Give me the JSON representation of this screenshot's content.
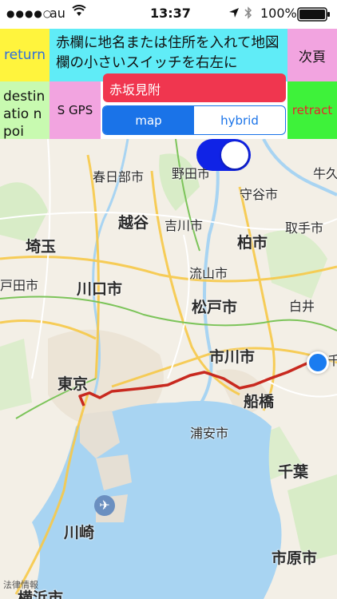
{
  "status": {
    "carrier": "au",
    "time": "13:37",
    "battery": "100%",
    "icons": [
      "signal-dots-icon",
      "wifi-icon",
      "location-arrow-icon",
      "bluetooth-icon",
      "battery-icon"
    ]
  },
  "controls": {
    "return_label": "return",
    "instruction": "赤欄に地名または住所を入れて地図欄の小さいスイッチを右左に",
    "next_label": "次頁",
    "destination_label": "destinatio n poi",
    "gps_label": "S GPS",
    "place_value": "赤坂見附",
    "map_label": "map",
    "hybrid_label": "hybrid",
    "retract_label": "retract",
    "selected_segment": "map",
    "toggle_on": true
  },
  "map": {
    "labels": {
      "noda": "野田市",
      "kasukabe": "春日部市",
      "moriya": "守谷市",
      "koshigaya": "越谷",
      "yoshikawa": "吉川市",
      "toride": "取手市",
      "saitama": "埼玉",
      "kashiwa": "柏市",
      "nagareyama": "流山市",
      "kawaguchi": "川口市",
      "toda": "戸田市",
      "matsudo": "松戸市",
      "shiroi": "白井",
      "ichikawa": "市川市",
      "tokyo": "東京",
      "funabashi": "船橋",
      "urayasu": "浦安市",
      "chiba": "千葉",
      "kawasaki": "川崎",
      "ichihara": "市原市",
      "yokohama": "横浜市",
      "ushiku": "牛久",
      "chi_edge": "千"
    },
    "legal": "法律情報"
  },
  "colors": {
    "route": "#c8291f",
    "accent_blue": "#1a73e8",
    "toggle": "#1023e6",
    "water": "#a8d4f2"
  }
}
